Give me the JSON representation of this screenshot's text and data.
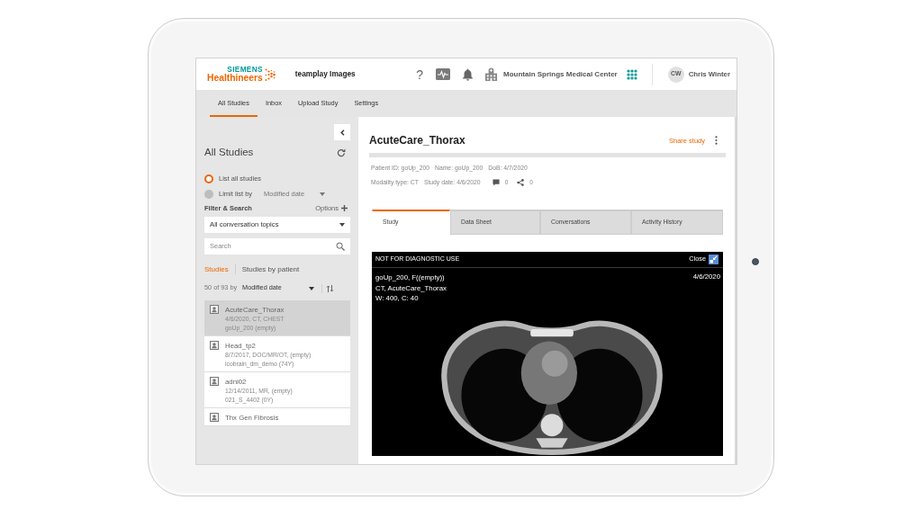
{
  "header": {
    "logo_top": "SIEMENS",
    "logo_bottom": "Healthineers",
    "app_name": "teamplay Images",
    "help_label": "?",
    "organization": "Mountain Springs Medical Center",
    "user": {
      "initials": "CW",
      "name": "Chris Winter"
    }
  },
  "nav_tabs": [
    {
      "label": "All Studies",
      "selected": true
    },
    {
      "label": "Inbox",
      "selected": false
    },
    {
      "label": "Upload Study",
      "selected": false
    },
    {
      "label": "Settings",
      "selected": false
    }
  ],
  "sidebar": {
    "title": "All Studies",
    "list_options": [
      {
        "label": "List all studies",
        "selected": true
      },
      {
        "label": "Limit list by",
        "selected": false,
        "dropdown": "Modified date"
      }
    ],
    "filter_title": "Filter & Search",
    "options_label": "Options",
    "topic_select": "All conversation topics",
    "search": {
      "placeholder": "Search"
    },
    "view_tabs": [
      {
        "label": "Studies",
        "selected": true
      },
      {
        "label": "Studies by patient",
        "selected": false
      }
    ],
    "count": "50 of 93 by",
    "sort_field": "Modified date",
    "studies": [
      {
        "title": "AcuteCare_Thorax",
        "lines": [
          "4/6/2020, CT, CHEST",
          "goUp_200 (empty)"
        ],
        "selected": true
      },
      {
        "title": "Head_tp2",
        "lines": [
          "8/7/2017, DOC/MR/OT, (empty)",
          "icobrain_dm_demo (74Y)"
        ],
        "selected": false
      },
      {
        "title": "adni02",
        "lines": [
          "12/14/2011, MR, (empty)",
          "021_S_4402 (0Y)"
        ],
        "selected": false
      },
      {
        "title": "Thx Gen Fibrosis",
        "selected": false
      }
    ]
  },
  "study": {
    "title": "AcuteCare_Thorax",
    "share_label": "Share study",
    "info_rows": [
      [
        "Patient ID: goUp_200",
        "Name: goUp_200",
        "DoB: 4/7/2020"
      ],
      [
        "Modality type: CT",
        "Study date: 4/6/2020"
      ]
    ],
    "comment_count": "0",
    "share_count": "0",
    "tabs": [
      {
        "label": "Study",
        "selected": true
      },
      {
        "label": "Data Sheet",
        "selected": false
      },
      {
        "label": "Conversations",
        "selected": false
      },
      {
        "label": "Activity History",
        "selected": false
      }
    ],
    "viewer": {
      "banner": "NOT FOR DIAGNOSTIC USE",
      "close_label": "Close",
      "overlay_lines": [
        "goUp_200, F((empty))",
        "CT, AcuteCare_Thorax",
        "W: 400, C: 40"
      ],
      "date": "4/6/2020"
    }
  }
}
